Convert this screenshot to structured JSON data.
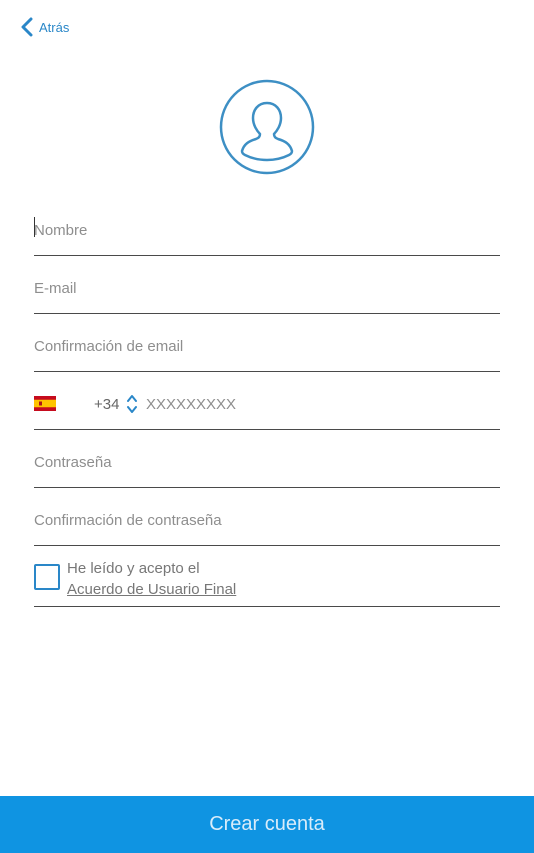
{
  "header": {
    "back_label": "Atrás"
  },
  "avatar": {
    "icon": "user-icon"
  },
  "form": {
    "name_placeholder": "Nombre",
    "email_placeholder": "E-mail",
    "email_confirm_placeholder": "Confirmación de email",
    "phone": {
      "country_flag": "spain-flag-icon",
      "code": "+34",
      "placeholder": "XXXXXXXXX"
    },
    "password_placeholder": "Contraseña",
    "password_confirm_placeholder": "Confirmación de contraseña",
    "terms": {
      "checked": false,
      "text": "He leído y acepto el",
      "link": "Acuerdo de Usuario Final"
    }
  },
  "submit_label": "Crear cuenta",
  "colors": {
    "accent": "#2a87c8",
    "button": "#0f94e2"
  }
}
